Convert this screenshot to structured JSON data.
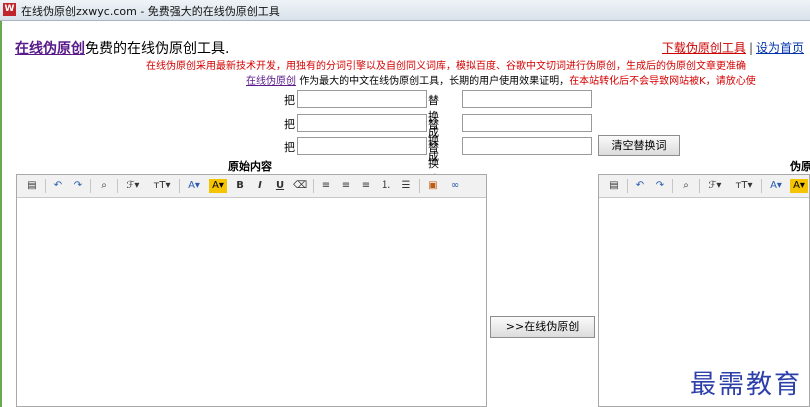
{
  "window": {
    "title": "在线伪原创zxwyc.com - 免费强大的在线伪原创工具",
    "icon": "app-icon"
  },
  "header": {
    "brand_link": "在线伪原创",
    "brand_suffix": "免费的在线伪原创工具.",
    "download_link": "下载伪原创工具",
    "separator": "|",
    "homepage_link": "设为首页"
  },
  "intro": {
    "line1": "在线伪原创采用最新技术开发，用独有的分词引擎以及自创同义词库，模拟百度、谷歌中文切词进行伪原创，生成后的伪原创文章更准确",
    "line2_link": "在线伪原创",
    "line2_black": "作为最大的中文在线伪原创工具，长期的用户使用效果证明，",
    "line2_red": "在本站转化后不会导致网站被K，请放心使"
  },
  "replace_rows": [
    {
      "label_from": "把",
      "label_to": "替换成",
      "value_from": "",
      "value_to": ""
    },
    {
      "label_from": "把",
      "label_to": "替换成",
      "value_from": "",
      "value_to": ""
    },
    {
      "label_from": "把",
      "label_to": "替换成",
      "value_from": "",
      "value_to": ""
    }
  ],
  "clear_button": "清空替换词",
  "original_title": "原始内容",
  "result_title": "伪原",
  "convert_button": ">>在线伪原创",
  "toolbar": {
    "source": "▤",
    "undo": "↶",
    "redo": "↷",
    "find": "⌕",
    "font_family": "ℱ▾",
    "font_size": "ᴛT▾",
    "font_color": "A▾",
    "highlight": "A▾",
    "bold": "B",
    "italic": "I",
    "underline": "U",
    "eraser": "⌫",
    "align_left": "≡",
    "align_center": "≡",
    "align_right": "≡",
    "ordered_list": "⒈",
    "unordered_list": "☰",
    "image": "▣",
    "link": "∞"
  },
  "watermark": "最需教育",
  "colors": {
    "brand": "#5a1a8a",
    "red": "#d40000",
    "link_blue": "#0033aa",
    "highlight": "#f5c400"
  }
}
